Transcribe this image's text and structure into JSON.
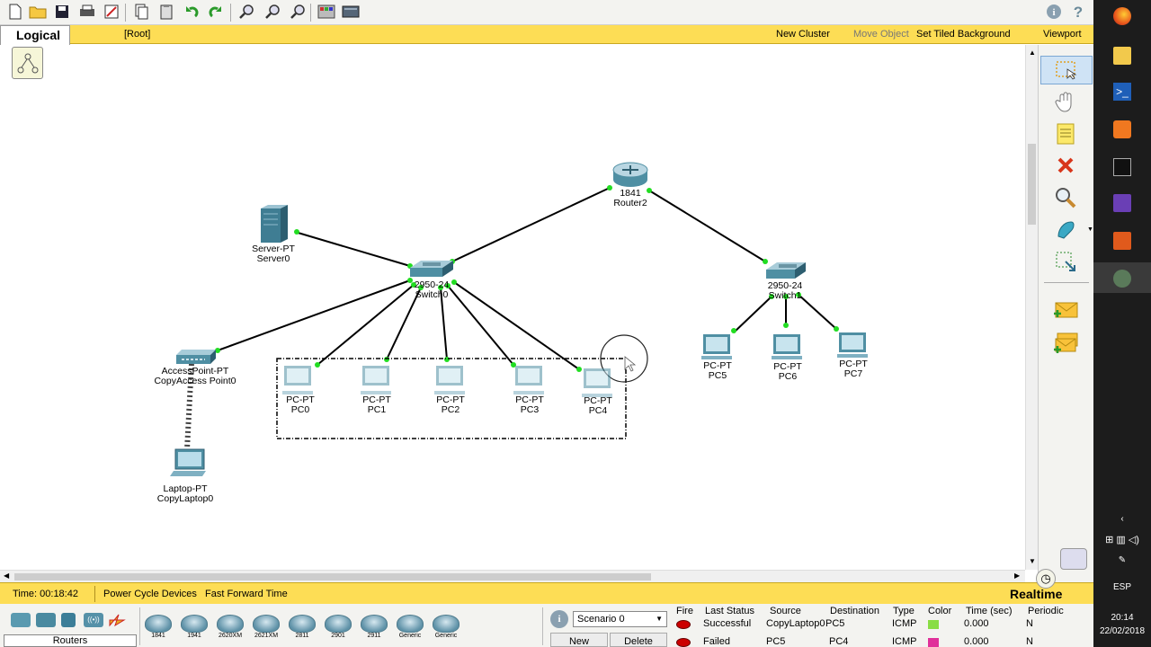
{
  "logical_bar": {
    "tab": "Logical",
    "root": "[Root]",
    "new_cluster": "New Cluster",
    "move_object": "Move Object",
    "set_tiled_background": "Set Tiled Background",
    "viewport": "Viewport"
  },
  "devices": [
    {
      "id": "router2",
      "model": "1841",
      "name": "Router2",
      "icon": "router-icon"
    },
    {
      "id": "server0",
      "model": "Server-PT",
      "name": "Server0",
      "icon": "server-icon"
    },
    {
      "id": "switch0",
      "model": "2950-24",
      "name": "Switch0",
      "icon": "switch-icon"
    },
    {
      "id": "switch1",
      "model": "2950-24",
      "name": "Switch1",
      "icon": "switch-icon"
    },
    {
      "id": "ap0",
      "model": "AccessPoint-PT",
      "name": "CopyAccess Point0",
      "icon": "access-point-icon"
    },
    {
      "id": "laptop0",
      "model": "Laptop-PT",
      "name": "CopyLaptop0",
      "icon": "laptop-icon"
    },
    {
      "id": "pc0",
      "model": "PC-PT",
      "name": "PC0",
      "icon": "pc-icon"
    },
    {
      "id": "pc1",
      "model": "PC-PT",
      "name": "PC1",
      "icon": "pc-icon"
    },
    {
      "id": "pc2",
      "model": "PC-PT",
      "name": "PC2",
      "icon": "pc-icon"
    },
    {
      "id": "pc3",
      "model": "PC-PT",
      "name": "PC3",
      "icon": "pc-icon"
    },
    {
      "id": "pc4",
      "model": "PC-PT",
      "name": "PC4",
      "icon": "pc-icon"
    },
    {
      "id": "pc5",
      "model": "PC-PT",
      "name": "PC5",
      "icon": "pc-icon"
    },
    {
      "id": "pc6",
      "model": "PC-PT",
      "name": "PC6",
      "icon": "pc-icon"
    },
    {
      "id": "pc7",
      "model": "PC-PT",
      "name": "PC7",
      "icon": "pc-icon"
    }
  ],
  "status_bar": {
    "time": "Time: 00:18:42",
    "power_cycle": "Power Cycle Devices",
    "fast_forward": "Fast Forward Time",
    "mode": "Realtime"
  },
  "device_panel": {
    "category": "Routers",
    "models": [
      "1841",
      "1941",
      "2620XM",
      "2621XM",
      "2811",
      "2901",
      "2911",
      "Generic",
      "Generic"
    ]
  },
  "scenario": {
    "selected": "Scenario 0",
    "new_label": "New",
    "delete_label": "Delete"
  },
  "pdu_table": {
    "headers": [
      "Fire",
      "Last Status",
      "Source",
      "Destination",
      "Type",
      "Color",
      "Time (sec)",
      "Periodic"
    ],
    "rows": [
      {
        "status": "Successful",
        "source": "CopyLaptop0",
        "destination": "PC5",
        "type": "ICMP",
        "color": "#88dd44",
        "time": "0.000",
        "periodic": "N"
      },
      {
        "status": "Failed",
        "source": "PC5",
        "destination": "PC4",
        "type": "ICMP",
        "color": "#e0309a",
        "time": "0.000",
        "periodic": "N"
      }
    ]
  },
  "taskbar": {
    "language": "ESP",
    "clock_time": "20:14",
    "clock_date": "22/02/2018"
  },
  "colors": {
    "accent_yellow": "#fddd55",
    "link_light": "#22dd22",
    "device_teal": "#4f8fa3"
  }
}
